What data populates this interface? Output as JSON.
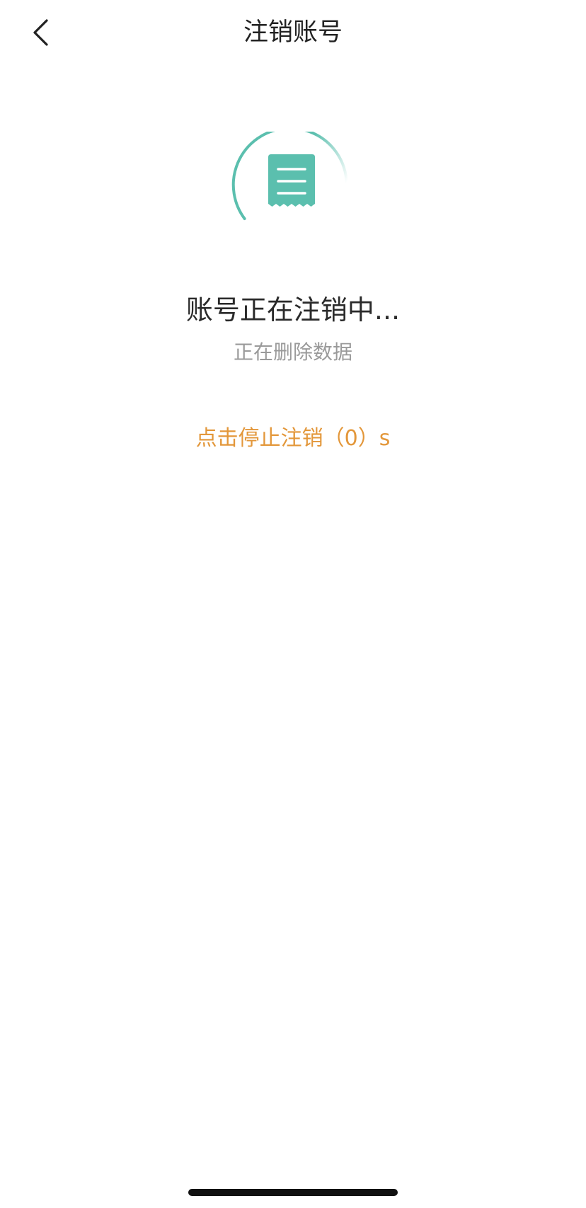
{
  "header": {
    "title": "注销账号",
    "back_icon": "chevron-left-icon"
  },
  "status": {
    "icon": "receipt-icon",
    "title": "账号正在注销中...",
    "subtitle": "正在删除数据"
  },
  "actions": {
    "stop_label": "点击停止注销（0）s"
  },
  "colors": {
    "accent_teal": "#5bbfae",
    "action_orange": "#e3973a",
    "subtitle_gray": "#9a9a9a"
  }
}
